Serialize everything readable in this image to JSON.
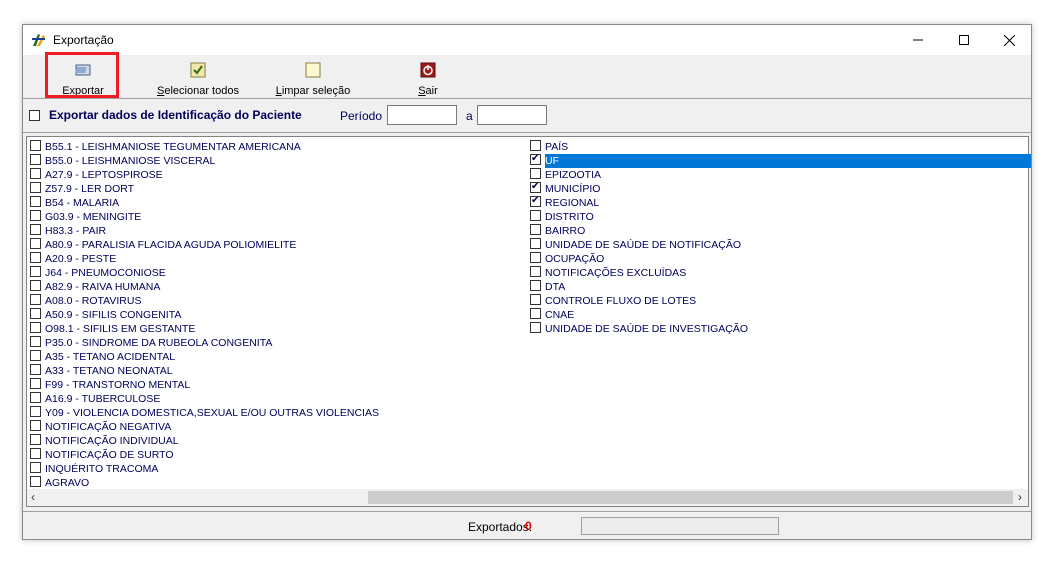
{
  "window": {
    "title": "Exportação"
  },
  "toolbar": {
    "export": {
      "label_u": "E",
      "label_rest": "xportar"
    },
    "select_all": {
      "label_u": "S",
      "label_rest": "elecionar todos"
    },
    "clear": {
      "label_u": "L",
      "label_rest": "impar seleção"
    },
    "exit": {
      "label_u": "S",
      "label_rest": "air"
    }
  },
  "options": {
    "export_id_label": "Exportar dados de Identificação do Paciente",
    "export_id_checked": false,
    "period_label": "Período",
    "period_from": "",
    "period_to_label": "a",
    "period_to": ""
  },
  "left_list": [
    {
      "label": "B55.1 - LEISHMANIOSE TEGUMENTAR AMERICANA",
      "checked": false
    },
    {
      "label": "B55.0 - LEISHMANIOSE VISCERAL",
      "checked": false
    },
    {
      "label": "A27.9 - LEPTOSPIROSE",
      "checked": false
    },
    {
      "label": "Z57.9 - LER DORT",
      "checked": false
    },
    {
      "label": "B54 - MALARIA",
      "checked": false
    },
    {
      "label": "G03.9 - MENINGITE",
      "checked": false
    },
    {
      "label": "H83.3 - PAIR",
      "checked": false
    },
    {
      "label": "A80.9 - PARALISIA FLACIDA AGUDA   POLIOMIELITE",
      "checked": false
    },
    {
      "label": "A20.9 - PESTE",
      "checked": false
    },
    {
      "label": "J64 - PNEUMOCONIOSE",
      "checked": false
    },
    {
      "label": "A82.9 - RAIVA HUMANA",
      "checked": false
    },
    {
      "label": "A08.0 - ROTAVIRUS",
      "checked": false
    },
    {
      "label": "A50.9 - SIFILIS CONGENITA",
      "checked": false
    },
    {
      "label": "O98.1 - SIFILIS EM GESTANTE",
      "checked": false
    },
    {
      "label": "P35.0 - SINDROME DA RUBEOLA CONGENITA",
      "checked": false
    },
    {
      "label": "A35 - TETANO ACIDENTAL",
      "checked": false
    },
    {
      "label": "A33 - TETANO NEONATAL",
      "checked": false
    },
    {
      "label": "F99 - TRANSTORNO MENTAL",
      "checked": false
    },
    {
      "label": "A16.9 - TUBERCULOSE",
      "checked": false
    },
    {
      "label": "Y09 - VIOLENCIA DOMESTICA,SEXUAL E/OU OUTRAS VIOLENCIAS",
      "checked": false
    },
    {
      "label": "NOTIFICAÇÃO NEGATIVA",
      "checked": false
    },
    {
      "label": "NOTIFICAÇÃO INDIVIDUAL",
      "checked": false
    },
    {
      "label": "NOTIFICAÇÃO DE SURTO",
      "checked": false
    },
    {
      "label": "INQUÉRITO TRACOMA",
      "checked": false
    },
    {
      "label": "AGRAVO",
      "checked": false
    }
  ],
  "right_list": [
    {
      "label": "PAÍS",
      "checked": false,
      "selected": false
    },
    {
      "label": "UF",
      "checked": true,
      "selected": true
    },
    {
      "label": "EPIZOOTIA",
      "checked": false,
      "selected": false
    },
    {
      "label": "MUNICÍPIO",
      "checked": true,
      "selected": false
    },
    {
      "label": "REGIONAL",
      "checked": true,
      "selected": false
    },
    {
      "label": "DISTRITO",
      "checked": false,
      "selected": false
    },
    {
      "label": "BAIRRO",
      "checked": false,
      "selected": false
    },
    {
      "label": "UNIDADE DE SAÚDE DE NOTIFICAÇÃO",
      "checked": false,
      "selected": false
    },
    {
      "label": "OCUPAÇÃO",
      "checked": false,
      "selected": false
    },
    {
      "label": "NOTIFICAÇÕES EXCLUÍDAS",
      "checked": false,
      "selected": false
    },
    {
      "label": "DTA",
      "checked": false,
      "selected": false
    },
    {
      "label": "CONTROLE FLUXO DE LOTES",
      "checked": false,
      "selected": false
    },
    {
      "label": "CNAE",
      "checked": false,
      "selected": false
    },
    {
      "label": "UNIDADE DE SAÚDE DE INVESTIGAÇÃO",
      "checked": false,
      "selected": false
    }
  ],
  "status": {
    "exported_label": "Exportados:",
    "exported_value": "0"
  },
  "colors": {
    "selection": "#0078d7",
    "highlight_box": "#ee1c25",
    "text_navy": "#00005a",
    "exported_value": "#e00000"
  },
  "icons": {
    "app": "sinan-app-icon",
    "export": "export-icon",
    "select_all": "select-all-icon",
    "clear": "clear-selection-icon",
    "exit": "exit-icon"
  }
}
